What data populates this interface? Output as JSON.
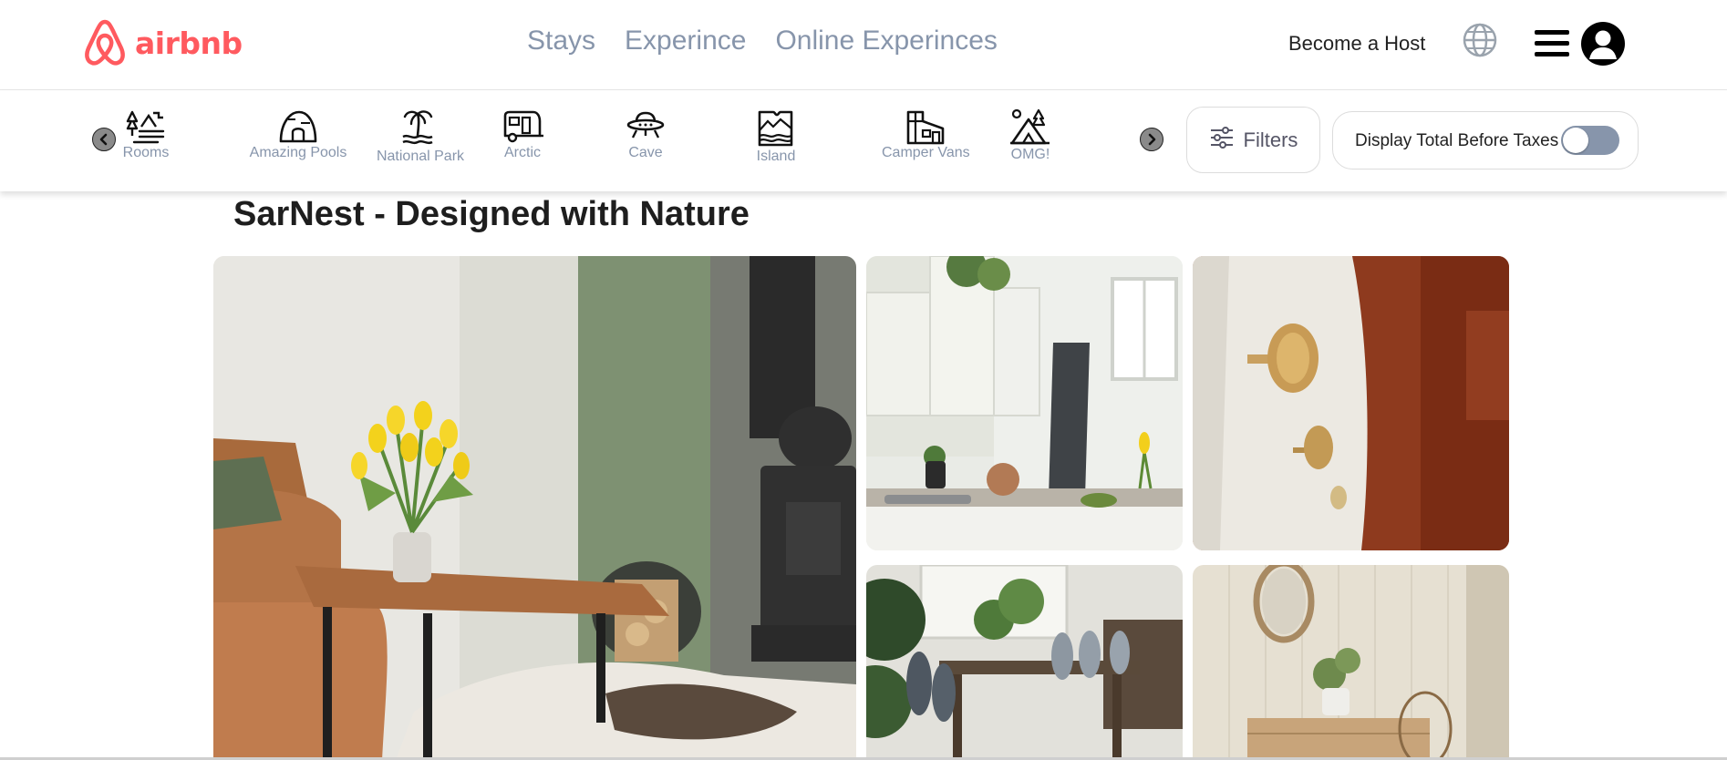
{
  "brand": {
    "name": "airbnb",
    "color": "#FF5A5F",
    "icon": "airbnb-logo-icon"
  },
  "nav": {
    "items": [
      "Stays",
      "Experince",
      "Online Experinces"
    ],
    "host_link": "Become a Host",
    "globe_icon": "globe-icon",
    "menu_icon": "hamburger-menu-icon",
    "avatar_icon": "user-avatar-icon"
  },
  "categories": {
    "prev_icon": "chevron-left-icon",
    "next_icon": "chevron-right-icon",
    "items": [
      {
        "label": "Rooms",
        "icon": "rooms-icon"
      },
      {
        "label": "Amazing Pools",
        "icon": "amazing-pools-icon"
      },
      {
        "label": "National Park",
        "icon": "national-park-icon"
      },
      {
        "label": "Arctic",
        "icon": "arctic-icon"
      },
      {
        "label": "Cave",
        "icon": "cave-icon"
      },
      {
        "label": "Island",
        "icon": "island-icon"
      },
      {
        "label": "Camper Vans",
        "icon": "camper-vans-icon"
      },
      {
        "label": "OMG!",
        "icon": "omg-icon"
      }
    ]
  },
  "filters": {
    "label": "Filters",
    "icon": "sliders-icon"
  },
  "taxes": {
    "label": "Display Total Before Taxes",
    "enabled": false
  },
  "listing": {
    "title": "SarNest - Designed with Nature",
    "photos": [
      {
        "name": "living-room-photo"
      },
      {
        "name": "kitchen-photo"
      },
      {
        "name": "cabinet-knobs-photo"
      },
      {
        "name": "dining-room-photo"
      },
      {
        "name": "mirror-dresser-photo"
      }
    ]
  },
  "colors": {
    "nav_text": "#8795AB",
    "toggle_off": "#8795AB"
  }
}
